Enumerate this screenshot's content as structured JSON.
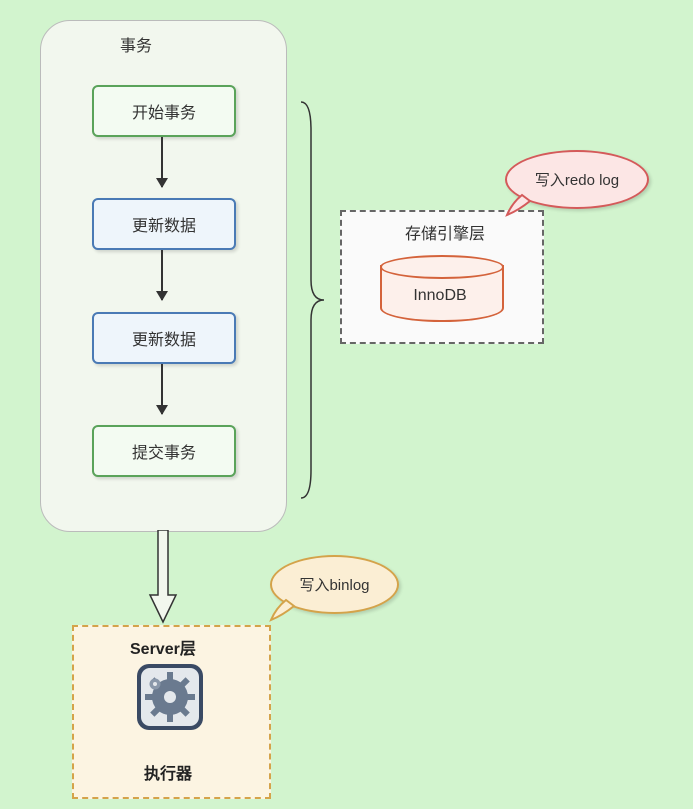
{
  "transaction": {
    "title": "事务",
    "steps": {
      "start": "开始事务",
      "update1": "更新数据",
      "update2": "更新数据",
      "commit": "提交事务"
    }
  },
  "storage_engine": {
    "title": "存储引擎层",
    "engine": "InnoDB"
  },
  "server_layer": {
    "title": "Server层",
    "executor": "执行器"
  },
  "callouts": {
    "redo_log": "写入redo log",
    "binlog": "写入binlog"
  }
}
